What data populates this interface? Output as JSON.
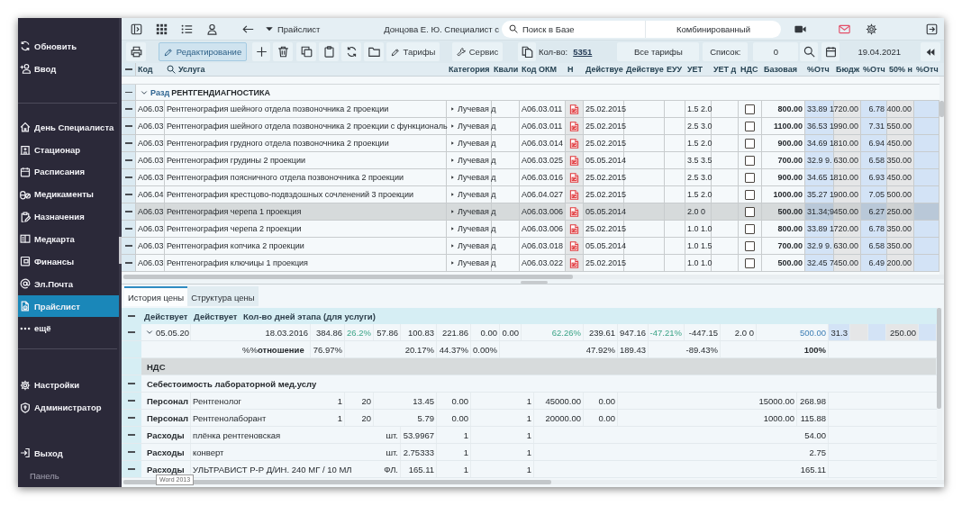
{
  "sidebar": {
    "actions": [
      {
        "label": "Обновить"
      },
      {
        "label": "Ввод"
      }
    ],
    "nav": [
      {
        "label": "День Специалиста",
        "selected": false
      },
      {
        "label": "Стационар",
        "selected": false
      },
      {
        "label": "Расписания",
        "selected": false
      },
      {
        "label": "Медикаменты",
        "selected": false
      },
      {
        "label": "Назначения",
        "selected": false
      },
      {
        "label": "Медкарта",
        "selected": false
      },
      {
        "label": "Финансы",
        "selected": false
      },
      {
        "label": "Эл.Почта",
        "selected": false
      },
      {
        "label": "Прайслист",
        "selected": true
      },
      {
        "label": "ещё",
        "selected": false
      }
    ],
    "settings": [
      {
        "label": "Настройки"
      },
      {
        "label": "Администратор"
      }
    ],
    "exit": {
      "label": "Выход"
    },
    "footer": "Панель"
  },
  "topbar": {
    "title": "Прайслист",
    "user": "Донцова Е. Ю. Специалист с",
    "search": {
      "placeholder": "Поиск в Базе"
    },
    "search_mode": "Комбинированный"
  },
  "toolbar": {
    "edit": {
      "label": "Редактирование",
      "active": true
    },
    "tariffs": "Тарифы",
    "service": "Сервис",
    "count_label": "Кол-во:",
    "count": "5351",
    "tariff_filter": "Все тарифы",
    "list_label": "Список:",
    "list_value": "0",
    "date": "19.04.2021"
  },
  "price_table": {
    "columns": [
      "Код",
      "Услуга",
      "Категория",
      "Квали",
      "Код ОКМ",
      "Н",
      "Действуе",
      "Действуе",
      "ЕУУ",
      "УЕТ",
      "УЕТ д",
      "НДС",
      "Базовая",
      "%Отч",
      "Бюдж",
      "%Отч",
      "50% н",
      "%Отч"
    ],
    "section": {
      "code": "Разд",
      "title": "РЕНТГЕНДИАГНОСТИКА",
      "expanded": true
    },
    "rows": [
      {
        "code": "A06.03",
        "service": "Рентгенография шейного отдела позвоночника 2 проекции",
        "category": "Лучевая д",
        "okmu_code": "A06.03.011",
        "valid_from": "25.02.2015",
        "uet": "1.5 2.0",
        "vat_checked": false,
        "base_price": "800.00",
        "report_pct_1": "33.89 1",
        "budget": "720.00",
        "report_pct_2": "6.78",
        "half_price": "400.00",
        "selected": false
      },
      {
        "code": "A06.03",
        "service": "Рентгенография шейного отдела позвоночника 2 проекции с функциональ",
        "category": "Лучевая д",
        "okmu_code": "A06.03.011",
        "valid_from": "25.02.2015",
        "uet": "2.5 3.0",
        "vat_checked": false,
        "base_price": "1100.00",
        "report_pct_1": "36.53 1",
        "budget": "990.00",
        "report_pct_2": "7.31",
        "half_price": "550.00",
        "selected": false
      },
      {
        "code": "A06.03",
        "service": "Рентгенография грудного отдела позвоночника 2 проекции",
        "category": "Лучевая д",
        "okmu_code": "A06.03.014",
        "valid_from": "25.02.2015",
        "uet": "1.5 2.0",
        "vat_checked": false,
        "base_price": "900.00",
        "report_pct_1": "34.69 1",
        "budget": "810.00",
        "report_pct_2": "6.94",
        "half_price": "450.00",
        "selected": false
      },
      {
        "code": "A06.03",
        "service": "Рентгенография грудины 2 проекции",
        "category": "Лучевая д",
        "okmu_code": "A06.03.025",
        "valid_from": "05.05.2014",
        "uet": "3.5 3.5",
        "vat_checked": false,
        "base_price": "700.00",
        "report_pct_1": "32.9 9.",
        "budget": "630.00",
        "report_pct_2": "6.58",
        "half_price": "350.00",
        "selected": false
      },
      {
        "code": "A06.03",
        "service": "Рентгенография поясничного отдела позвоночника 2 проекции",
        "category": "Лучевая д",
        "okmu_code": "A06.03.016",
        "valid_from": "25.02.2015",
        "uet": "2.5 3.0",
        "vat_checked": false,
        "base_price": "900.00",
        "report_pct_1": "34.65 1",
        "budget": "810.00",
        "report_pct_2": "6.93",
        "half_price": "450.00",
        "selected": false
      },
      {
        "code": "A06.04",
        "service": "Рентгенография крестцово-подвздошных сочленений 3 проекции",
        "category": "Лучевая д",
        "okmu_code": "A06.04.027",
        "valid_from": "25.02.2015",
        "uet": "1.5 2.0",
        "vat_checked": false,
        "base_price": "1000.00",
        "report_pct_1": "35.27 1",
        "budget": "900.00",
        "report_pct_2": "7.05",
        "half_price": "500.00",
        "selected": false
      },
      {
        "code": "A06.03",
        "service": "Рентгенография черепа 1 проекция",
        "category": "Лучевая д",
        "okmu_code": "A06.03.006",
        "valid_from": "05.05.2014",
        "uet": "2.0 0",
        "vat_checked": false,
        "base_price": "500.00",
        "report_pct_1": "31.34;9",
        "budget": "450.00",
        "report_pct_2": "6.27",
        "half_price": "250.00",
        "selected": true
      },
      {
        "code": "A06.03",
        "service": "Рентгенография черепа 2 проекции",
        "category": "Лучевая д",
        "okmu_code": "A06.03.006",
        "valid_from": "25.02.2015",
        "uet": "1.0 1.0",
        "vat_checked": false,
        "base_price": "800.00",
        "report_pct_1": "33.89 1",
        "budget": "720.00",
        "report_pct_2": "6.78",
        "half_price": "350.00",
        "selected": false
      },
      {
        "code": "A06.03",
        "service": "Рентгенография копчика 2 проекции",
        "category": "Лучевая д",
        "okmu_code": "A06.03.018",
        "valid_from": "05.05.2014",
        "uet": "1.0 1.5",
        "vat_checked": false,
        "base_price": "700.00",
        "report_pct_1": "32.9 9.",
        "budget": "630.00",
        "report_pct_2": "6.58",
        "half_price": "350.00",
        "selected": false
      },
      {
        "code": "A06.03",
        "service": "Рентгенография ключицы 1 проекция",
        "category": "Лучевая д",
        "okmu_code": "A06.03.022",
        "valid_from": "25.02.2015",
        "uet": "1.0 1.0",
        "vat_checked": false,
        "base_price": "500.00",
        "report_pct_1": "32.45 7",
        "budget": "450.00",
        "report_pct_2": "6.49",
        "half_price": "200.00",
        "selected": false
      }
    ]
  },
  "details": {
    "tabs": [
      {
        "label": "История цены",
        "selected": true
      },
      {
        "label": "Структура цены",
        "selected": false
      }
    ],
    "columns": [
      "Действует",
      "Действует",
      "Кол-во дней этапа (для услуги)"
    ],
    "rows": [
      {
        "kind": "period",
        "expanded": true,
        "date": "05.05.20",
        "column_3": "18.03.2016",
        "column_4": "384.86",
        "column_5": "26.2%",
        "column_6": "57.86",
        "column_7": "100.83",
        "column_8": "221.86",
        "column_9": "0.00",
        "column_10": "0.00",
        "column_13": "62.26%",
        "column_14": "239.61",
        "column_15": "947.16",
        "column_16": "-47.21%",
        "column_17": "-447.15",
        "column_19": "2.0 0",
        "column_21": "500.00",
        "column_22": "31.3",
        "column_25": "250.00"
      },
      {
        "kind": "ratio",
        "label": "%%**отношение**",
        "column_4": "76.97%",
        "column_7": "20.17%",
        "column_8": "44.37%",
        "column_9": "0.00%",
        "column_14": "47.92%",
        "column_15": "189.43",
        "column_17": "-89.43%",
        "column_21": "100%"
      },
      {
        "kind": "group",
        "label": "НДС"
      },
      {
        "kind": "section",
        "label": "Себестоимость лабораторной мед.услу"
      },
      {
        "kind": "item",
        "category": "Персонал",
        "name": "Рентгенолог",
        "column_4": "1",
        "column_5": "20",
        "column_7": "13.45",
        "column_8": "0.00",
        "column_11": "1",
        "column_13": "45000.00",
        "column_14": "0.00",
        "column_20": "15000.00",
        "column_21": "268.98"
      },
      {
        "kind": "item",
        "category": "Персонал",
        "name": "Рентгенолаборант",
        "column_4": "1",
        "column_5": "20",
        "column_7": "5.79",
        "column_8": "0.00",
        "column_11": "1",
        "column_13": "20000.00",
        "column_14": "0.00",
        "column_20": "1000.00",
        "column_21": "115.88"
      },
      {
        "kind": "item",
        "category": "Расходы",
        "name": "плёнка рентгеновская",
        "column_6": "шт.",
        "column_7": "53.9967",
        "column_8": "1",
        "column_11": "1",
        "column_21": "54.00"
      },
      {
        "kind": "item",
        "category": "Расходы",
        "name": "конверт",
        "column_6": "шт.",
        "column_7": "2.75333",
        "column_8": "1",
        "column_11": "1",
        "column_21": "2.75"
      },
      {
        "kind": "item",
        "category": "Расходы",
        "name": "УЛЬТРАВИСТ Р-Р Д/ИН. 240 МГ / 10 МЛ",
        "column_6": "ФЛ.",
        "column_7": "165.11",
        "column_8": "1",
        "column_11": "1",
        "column_21": "165.11"
      }
    ],
    "tooltip": "Word 2013"
  }
}
